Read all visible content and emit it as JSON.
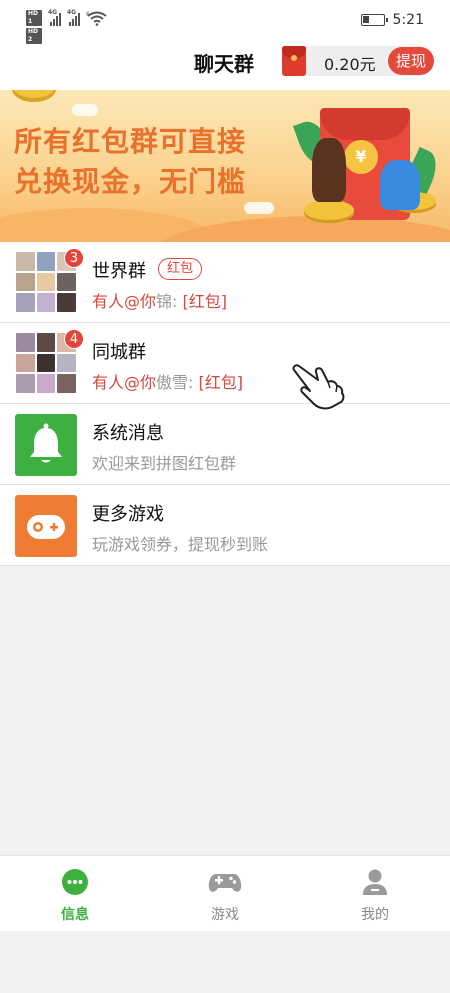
{
  "status_bar": {
    "hd1": "HD 1",
    "hd2": "HD 2",
    "net1": "4G",
    "net2": "4G",
    "wifi": "6",
    "time": "5:21"
  },
  "header": {
    "title": "聊天群",
    "balance": "0.20元",
    "withdraw_label": "提现"
  },
  "banner": {
    "line1": "所有红包群可直接",
    "line2": "兑换现金，无门槛",
    "coin_symbol": "¥"
  },
  "chats": [
    {
      "title": "世界群",
      "tag": "红包",
      "badge": "3",
      "mention": "有人@你",
      "sender": "锦:",
      "content": "[红包]"
    },
    {
      "title": "同城群",
      "badge": "4",
      "mention": "有人@你",
      "sender": "傲雪:",
      "content": "[红包]"
    }
  ],
  "system": {
    "title": "系统消息",
    "subtitle": "欢迎来到拼图红包群"
  },
  "games": {
    "title": "更多游戏",
    "subtitle": "玩游戏领券，提现秒到账"
  },
  "tabs": [
    {
      "label": "信息",
      "icon": "chat-bubble-icon",
      "active": true
    },
    {
      "label": "游戏",
      "icon": "gamepad-icon",
      "active": false
    },
    {
      "label": "我的",
      "icon": "user-icon",
      "active": false
    }
  ],
  "colors": {
    "accent_green": "#3eb040",
    "accent_red": "#e3453a",
    "games_orange": "#ee7c33"
  }
}
